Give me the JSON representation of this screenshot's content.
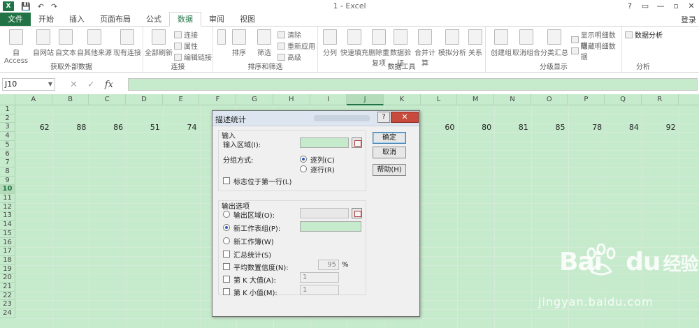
{
  "window": {
    "title": "1 - Excel",
    "controls": [
      "?",
      "▭",
      "—",
      "▫",
      "✕"
    ]
  },
  "quick_access": [
    "💾",
    "↶",
    "↷"
  ],
  "tabs": [
    {
      "label": "文件"
    },
    {
      "label": "开始"
    },
    {
      "label": "插入"
    },
    {
      "label": "页面布局"
    },
    {
      "label": "公式"
    },
    {
      "label": "数据"
    },
    {
      "label": "审阅"
    },
    {
      "label": "视图"
    }
  ],
  "active_tab": "数据",
  "login": "登录",
  "ribbon": {
    "groups": [
      {
        "label": "获取外部数据",
        "buttons": [
          "自 Access",
          "自网站",
          "自文本",
          "自其他来源",
          "现有连接"
        ]
      },
      {
        "label": "连接",
        "buttons": [
          "全部刷新"
        ],
        "small": [
          "连接",
          "属性",
          "编辑链接"
        ]
      },
      {
        "label": "排序和筛选",
        "buttons": [
          "排序",
          "筛选"
        ],
        "small": [
          "清除",
          "重新应用",
          "高级"
        ]
      },
      {
        "label": "数据工具",
        "buttons": [
          "分列",
          "快速填充",
          "删除重复项",
          "数据验证",
          "合并计算",
          "模拟分析",
          "关系"
        ]
      },
      {
        "label": "分级显示",
        "buttons": [
          "创建组",
          "取消组合",
          "分类汇总"
        ],
        "small": [
          "显示明细数据",
          "隐藏明细数据"
        ]
      },
      {
        "label": "分析",
        "buttons": [
          "数据分析"
        ]
      }
    ]
  },
  "formula_bar": {
    "name_box": "J10",
    "formula": ""
  },
  "columns": [
    "A",
    "B",
    "C",
    "D",
    "E",
    "F",
    "G",
    "H",
    "I",
    "J",
    "K",
    "L",
    "M",
    "N",
    "O",
    "P",
    "Q",
    "R"
  ],
  "selected_column": "J",
  "rows": [
    "1",
    "2",
    "3",
    "4",
    "5",
    "6",
    "7",
    "8",
    "9",
    "10",
    "11",
    "12",
    "13",
    "14",
    "15",
    "16",
    "17",
    "18",
    "19",
    "20",
    "21",
    "22",
    "23",
    "24"
  ],
  "selected_row": "10",
  "row3_values": {
    "A": "62",
    "B": "88",
    "C": "86",
    "D": "51",
    "E": "74",
    "L": "60",
    "M": "80",
    "N": "81",
    "O": "85",
    "P": "78",
    "Q": "84",
    "R": "92"
  },
  "dialog": {
    "title": "描述统计",
    "input_section": "输入",
    "input_range_label": "输入区域(I):",
    "group_by_label": "分组方式:",
    "by_columns": "逐列(C)",
    "by_rows": "逐行(R)",
    "labels_first_row": "标志位于第一行(L)",
    "output_section": "输出选项",
    "output_range": "输出区域(O):",
    "new_sheet": "新工作表组(P):",
    "new_workbook": "新工作簿(W)",
    "summary_stats": "汇总统计(S)",
    "confidence_label": "平均数置信度(N):",
    "confidence_value": "95",
    "percent": "%",
    "kth_largest": "第 K 大值(A):",
    "kth_largest_value": "1",
    "kth_smallest": "第 K 小值(M):",
    "kth_smallest_value": "1",
    "ok": "确定",
    "cancel": "取消",
    "help": "帮助(H)",
    "help_icon": "?",
    "close_icon": "✕"
  },
  "watermark": {
    "brand": "Bai",
    "brand_suffix": "du",
    "brand_cn": "经验",
    "url": "jingyan.baidu.com"
  }
}
